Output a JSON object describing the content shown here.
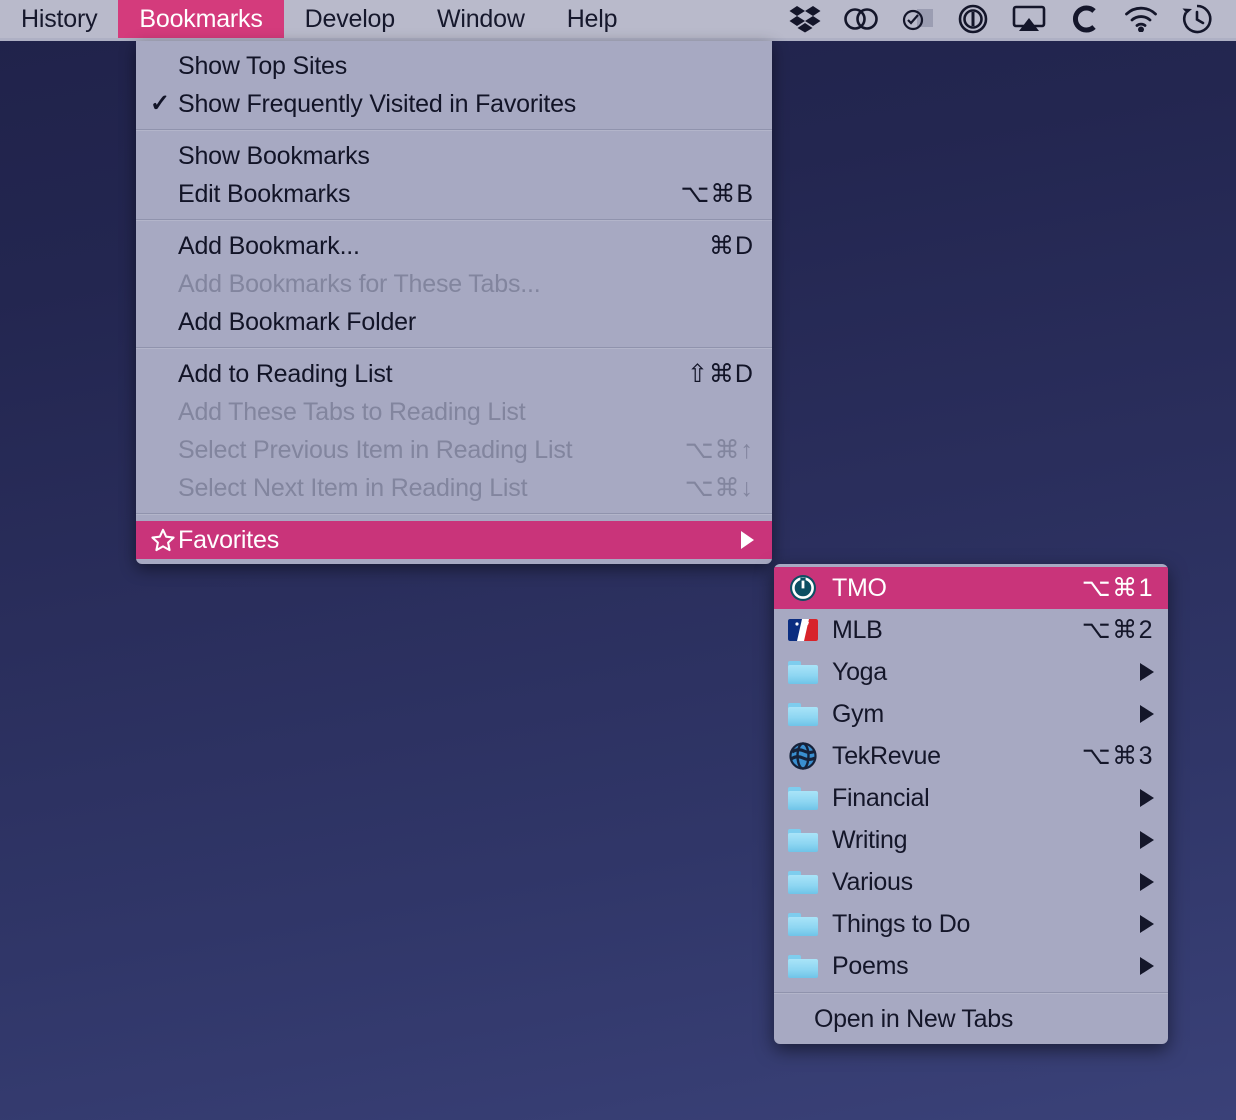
{
  "menubar": {
    "items": [
      {
        "label": "History",
        "active": false
      },
      {
        "label": "Bookmarks",
        "active": true
      },
      {
        "label": "Develop",
        "active": false
      },
      {
        "label": "Window",
        "active": false
      },
      {
        "label": "Help",
        "active": false
      }
    ],
    "status_icons": [
      {
        "name": "dropbox-icon"
      },
      {
        "name": "creative-cloud-icon"
      },
      {
        "name": "bartender-icon"
      },
      {
        "name": "onepassword-icon"
      },
      {
        "name": "airplay-icon"
      },
      {
        "name": "cleanmymac-icon"
      },
      {
        "name": "wifi-icon"
      },
      {
        "name": "time-machine-icon"
      }
    ],
    "accent_color": "#d43b7c",
    "bar_color": "#b9bacb"
  },
  "bookmarks_menu": {
    "groups": [
      {
        "items": [
          {
            "label": "Show Top Sites",
            "shortcut": "",
            "disabled": false,
            "checked": false
          },
          {
            "label": "Show Frequently Visited in Favorites",
            "shortcut": "",
            "disabled": false,
            "checked": true
          }
        ]
      },
      {
        "items": [
          {
            "label": "Show Bookmarks",
            "shortcut": "",
            "disabled": false,
            "checked": false
          },
          {
            "label": "Edit Bookmarks",
            "shortcut": "⌥⌘B",
            "disabled": false,
            "checked": false
          }
        ]
      },
      {
        "items": [
          {
            "label": "Add Bookmark...",
            "shortcut": "⌘D",
            "disabled": false,
            "checked": false
          },
          {
            "label": "Add Bookmarks for These Tabs...",
            "shortcut": "",
            "disabled": true,
            "checked": false
          },
          {
            "label": "Add Bookmark Folder",
            "shortcut": "",
            "disabled": false,
            "checked": false
          }
        ]
      },
      {
        "items": [
          {
            "label": "Add to Reading List",
            "shortcut": "⇧⌘D",
            "disabled": false,
            "checked": false
          },
          {
            "label": "Add These Tabs to Reading List",
            "shortcut": "",
            "disabled": true,
            "checked": false
          },
          {
            "label": "Select Previous Item in Reading List",
            "shortcut": "⌥⌘↑",
            "disabled": true,
            "checked": false
          },
          {
            "label": "Select Next Item in Reading List",
            "shortcut": "⌥⌘↓",
            "disabled": true,
            "checked": false
          }
        ]
      }
    ],
    "favorites_row": {
      "label": "Favorites",
      "icon": "star-outline-icon",
      "has_submenu": true,
      "highlighted": true
    },
    "highlight_color": "#c9347a",
    "panel_color": "#a7a9c2"
  },
  "favorites_submenu": {
    "items": [
      {
        "label": "TMO",
        "icon": "tmo-power-icon",
        "shortcut": "⌥⌘1",
        "submenu": false,
        "highlighted": true
      },
      {
        "label": "MLB",
        "icon": "mlb-logo-icon",
        "shortcut": "⌥⌘2",
        "submenu": false,
        "highlighted": false
      },
      {
        "label": "Yoga",
        "icon": "folder-icon",
        "shortcut": "",
        "submenu": true,
        "highlighted": false
      },
      {
        "label": "Gym",
        "icon": "folder-icon",
        "shortcut": "",
        "submenu": true,
        "highlighted": false
      },
      {
        "label": "TekRevue",
        "icon": "tekrevue-globe-icon",
        "shortcut": "⌥⌘3",
        "submenu": false,
        "highlighted": false
      },
      {
        "label": "Financial",
        "icon": "folder-icon",
        "shortcut": "",
        "submenu": true,
        "highlighted": false
      },
      {
        "label": "Writing",
        "icon": "folder-icon",
        "shortcut": "",
        "submenu": true,
        "highlighted": false
      },
      {
        "label": "Various",
        "icon": "folder-icon",
        "shortcut": "",
        "submenu": true,
        "highlighted": false
      },
      {
        "label": "Things to Do",
        "icon": "folder-icon",
        "shortcut": "",
        "submenu": true,
        "highlighted": false
      },
      {
        "label": "Poems",
        "icon": "folder-icon",
        "shortcut": "",
        "submenu": true,
        "highlighted": false
      }
    ],
    "footer": {
      "label": "Open in New Tabs"
    }
  },
  "desktop": {
    "background_top": "#20224a",
    "background_bottom": "#3a4178"
  }
}
